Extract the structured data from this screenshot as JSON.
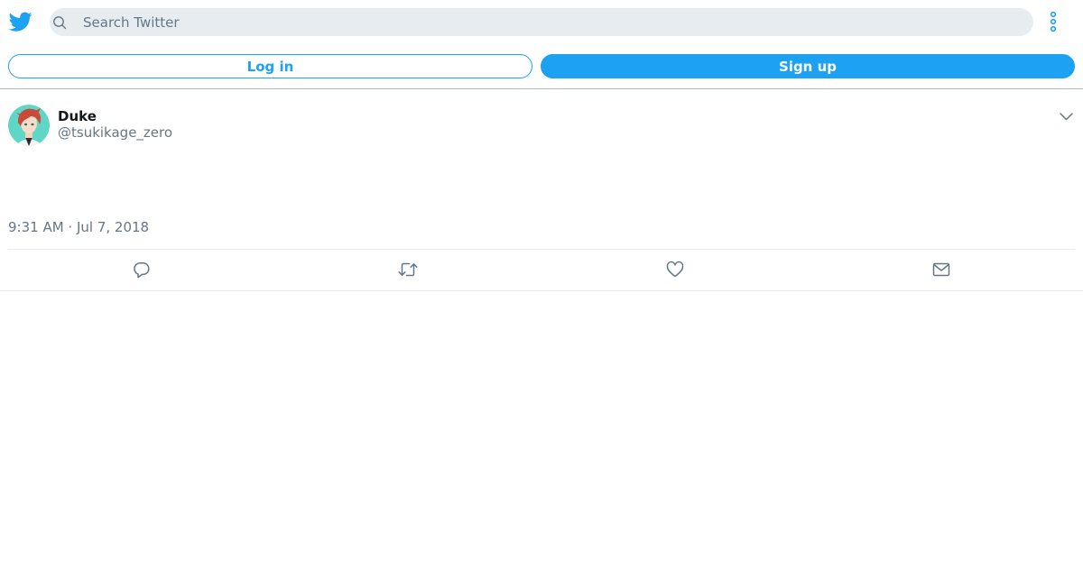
{
  "header": {
    "logo_icon": "twitter-bird-icon",
    "search": {
      "placeholder": "Search Twitter",
      "value": ""
    },
    "more_icon": "vertical-dots-icon"
  },
  "auth": {
    "login_label": "Log in",
    "signup_label": "Sign up"
  },
  "tweet": {
    "author_name": "Duke",
    "author_handle": "@tsukikage_zero",
    "timestamp": "9:31 AM · Jul 7, 2018",
    "actions": [
      "reply-icon",
      "retweet-icon",
      "like-icon",
      "share-dm-icon"
    ]
  },
  "colors": {
    "brand": "#1da1f2",
    "secondary_text": "#657786",
    "search_bg": "#e6ecf0"
  }
}
